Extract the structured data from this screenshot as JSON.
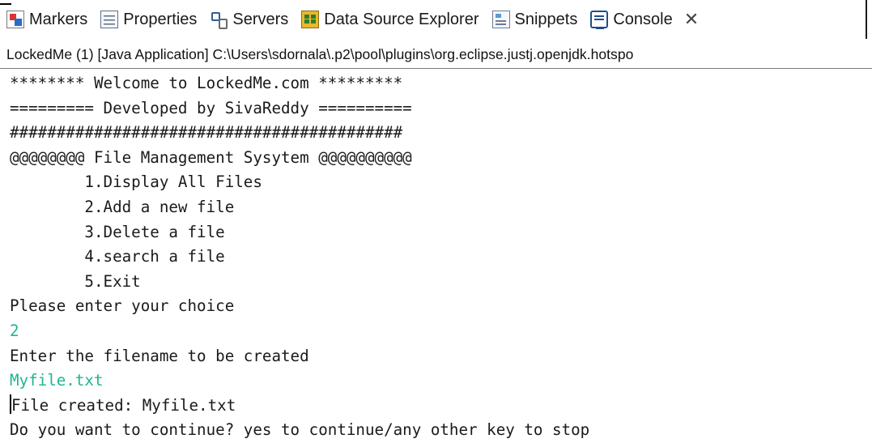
{
  "tabs": [
    {
      "label": "Markers",
      "icon": "markers-icon"
    },
    {
      "label": "Properties",
      "icon": "properties-icon"
    },
    {
      "label": "Servers",
      "icon": "servers-icon"
    },
    {
      "label": "Data Source Explorer",
      "icon": "data-source-explorer-icon"
    },
    {
      "label": "Snippets",
      "icon": "snippets-icon"
    },
    {
      "label": "Console",
      "icon": "console-icon",
      "active": true
    }
  ],
  "close_glyph": "✕",
  "launch_path": "LockedMe (1) [Java Application] C:\\Users\\sdornala\\.p2\\pool\\plugins\\org.eclipse.justj.openjdk.hotspo",
  "console": {
    "lines": [
      {
        "text": "******** Welcome to LockedMe.com *********",
        "type": "output"
      },
      {
        "text": "========= Developed by SivaReddy ==========",
        "type": "output"
      },
      {
        "text": "##########################################",
        "type": "output"
      },
      {
        "text": "@@@@@@@@ File Management Sysytem @@@@@@@@@@",
        "type": "output"
      },
      {
        "text": "        1.Display All Files",
        "type": "output"
      },
      {
        "text": "        2.Add a new file",
        "type": "output"
      },
      {
        "text": "        3.Delete a file",
        "type": "output"
      },
      {
        "text": "        4.search a file",
        "type": "output"
      },
      {
        "text": "        5.Exit",
        "type": "output"
      },
      {
        "text": "Please enter your choice",
        "type": "output"
      },
      {
        "text": "2",
        "type": "input"
      },
      {
        "text": "Enter the filename to be created",
        "type": "output"
      },
      {
        "text": "Myfile.txt",
        "type": "input"
      },
      {
        "text": "File created: Myfile.txt",
        "type": "output",
        "caret": true
      },
      {
        "text": "Do you want to continue? yes to continue/any other key to stop",
        "type": "output"
      }
    ],
    "colors": {
      "output": "#1a1a1a",
      "input": "#21b592"
    }
  }
}
